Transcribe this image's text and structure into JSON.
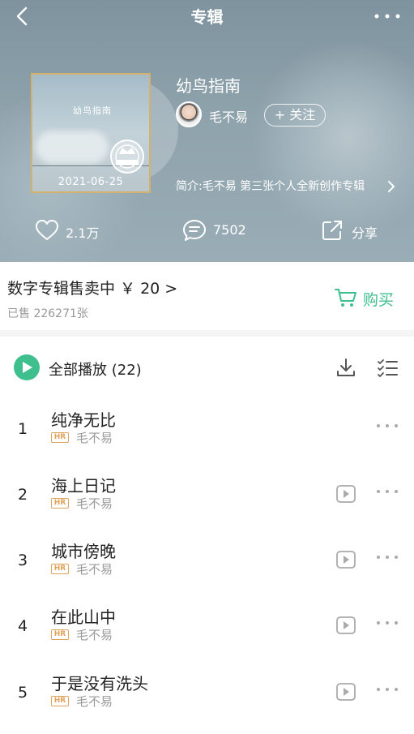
{
  "header": {
    "title": "专辑",
    "back_icon": "chevron-left-icon",
    "more_icon": "more-horizontal-icon"
  },
  "album": {
    "cover_title": "幼鸟指南",
    "cover_date": "2021-06-25",
    "title": "幼鸟指南",
    "artist": "毛不易",
    "follow_label": "+ 关注",
    "intro": "简介:毛不易 第三张个人全新创作专辑"
  },
  "stats": {
    "likes": "2.1万",
    "comments": "7502",
    "share_label": "分享"
  },
  "purchase": {
    "text": "数字专辑售卖中 ￥ 20 >",
    "sold": "已售 226271张",
    "buy_label": "购买",
    "accent_color": "#3fbf8e"
  },
  "play_all": {
    "label": "全部播放",
    "count": "(22)"
  },
  "songs": [
    {
      "index": "1",
      "title": "纯净无比",
      "quality": "HR",
      "artist": "毛不易",
      "has_video": false
    },
    {
      "index": "2",
      "title": "海上日记",
      "quality": "HR",
      "artist": "毛不易",
      "has_video": true
    },
    {
      "index": "3",
      "title": "城市傍晚",
      "quality": "HR",
      "artist": "毛不易",
      "has_video": true
    },
    {
      "index": "4",
      "title": "在此山中",
      "quality": "HR",
      "artist": "毛不易",
      "has_video": true
    },
    {
      "index": "5",
      "title": "于是没有洗头",
      "quality": "HR",
      "artist": "毛不易",
      "has_video": true
    }
  ]
}
